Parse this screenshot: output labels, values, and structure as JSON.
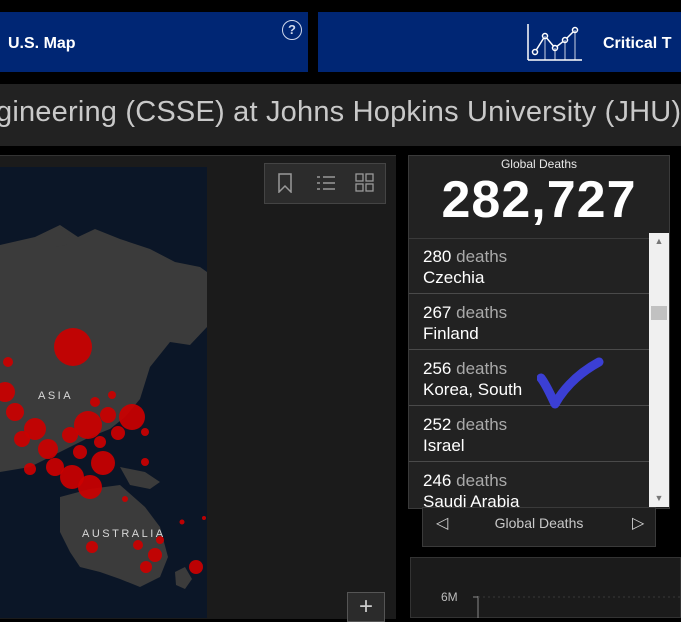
{
  "nav": {
    "left_label": "U.S. Map",
    "help_icon": "?",
    "right_label": "Critical T",
    "chart_icon": "line-chart-icon"
  },
  "title": "gineering (CSSE) at Johns Hopkins University (JHU)",
  "map": {
    "labels": [
      "ASIA",
      "AUSTRALIA"
    ],
    "tools": [
      "bookmark-icon",
      "legend-list-icon",
      "basemap-gallery-icon"
    ],
    "zoom_in": "+",
    "point_color": "#cc0000"
  },
  "deaths": {
    "title": "Global Deaths",
    "total": "282,727",
    "unit": "deaths",
    "items": [
      {
        "count": "280",
        "country": "Czechia"
      },
      {
        "count": "267",
        "country": "Finland"
      },
      {
        "count": "256",
        "country": "Korea, South"
      },
      {
        "count": "252",
        "country": "Israel"
      },
      {
        "count": "246",
        "country": "Saudi Arabia"
      }
    ]
  },
  "pager": {
    "label": "Global Deaths",
    "prev": "◁",
    "next": "▷"
  },
  "chart": {
    "tick": "6M"
  },
  "colors": {
    "nav": "#002674",
    "annotation": "#3b3fd4"
  }
}
